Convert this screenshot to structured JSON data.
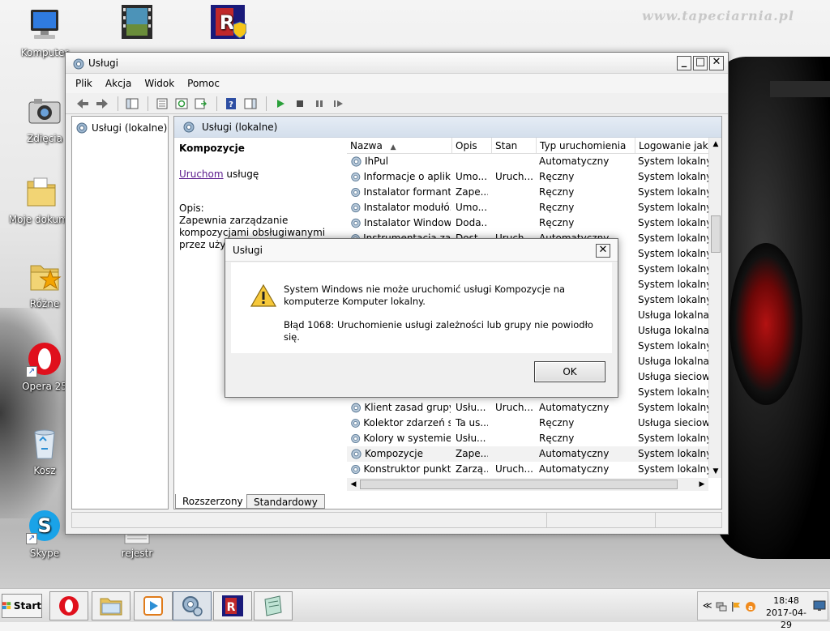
{
  "desktop": {
    "watermark": "www.tapeciarnia.pl",
    "icons": [
      {
        "label": "Komputer"
      },
      {
        "label": "Zdięcia"
      },
      {
        "label": "Moje dokume"
      },
      {
        "label": "Różne"
      },
      {
        "label": "Opera 25"
      },
      {
        "label": "Kosz"
      },
      {
        "label": "Skype"
      },
      {
        "label": "rejestr"
      }
    ]
  },
  "window": {
    "title": "Usługi",
    "menu": [
      "Plik",
      "Akcja",
      "Widok",
      "Pomoc"
    ],
    "tree_item": "Usługi (lokalne)",
    "pane_title": "Usługi (lokalne)",
    "selected_service": "Kompozycje",
    "start_link": "Uruchom",
    "start_suffix": " usługę",
    "desc_label": "Opis:",
    "desc_text": "Zapewnia zarządzanie kompozycjami obsługiwanymi przez użytkownika.",
    "columns": [
      "Nazwa",
      "Opis",
      "Stan",
      "Typ uruchomienia",
      "Logowanie jako"
    ],
    "rows": [
      {
        "name": "IhPul",
        "opis": "",
        "stan": "",
        "typ": "Automatyczny",
        "log": "System lokalny"
      },
      {
        "name": "Informacje o aplik...",
        "opis": "Umo...",
        "stan": "Uruch...",
        "typ": "Ręczny",
        "log": "System lokalny"
      },
      {
        "name": "Instalator formant...",
        "opis": "Zape...",
        "stan": "",
        "typ": "Ręczny",
        "log": "System lokalny"
      },
      {
        "name": "Instalator modułó...",
        "opis": "Umo...",
        "stan": "",
        "typ": "Ręczny",
        "log": "System lokalny"
      },
      {
        "name": "Instalator Windows",
        "opis": "Doda...",
        "stan": "",
        "typ": "Ręczny",
        "log": "System lokalny"
      },
      {
        "name": "Instrumentacja zar...",
        "opis": "Dost...",
        "stan": "Uruch...",
        "typ": "Automatyczny",
        "log": "System lokalny"
      },
      {
        "name": "",
        "opis": "",
        "stan": "",
        "typ": "",
        "log": "System lokalny"
      },
      {
        "name": "",
        "opis": "",
        "stan": "",
        "typ": "",
        "log": "System lokalny"
      },
      {
        "name": "",
        "opis": "",
        "stan": "",
        "typ": "",
        "log": "System lokalny"
      },
      {
        "name": "",
        "opis": "",
        "stan": "",
        "typ": "",
        "log": "System lokalny"
      },
      {
        "name": "",
        "opis": "",
        "stan": "",
        "typ": "",
        "log": "Usługa lokalna"
      },
      {
        "name": "",
        "opis": "",
        "stan": "",
        "typ": "",
        "log": "Usługa lokalna"
      },
      {
        "name": "",
        "opis": "",
        "stan": "",
        "typ": "",
        "log": "System lokalny"
      },
      {
        "name": "",
        "opis": "",
        "stan": "",
        "typ": "",
        "log": "Usługa lokalna"
      },
      {
        "name": "",
        "opis": "",
        "stan": "",
        "typ": "",
        "log": "Usługa sieciowa"
      },
      {
        "name": "",
        "opis": "",
        "stan": "",
        "typ": "",
        "log": "System lokalny"
      },
      {
        "name": "Klient zasad grupy",
        "opis": "Usłu...",
        "stan": "Uruch...",
        "typ": "Automatyczny",
        "log": "System lokalny"
      },
      {
        "name": "Kolektor zdarzeń s...",
        "opis": "Ta us...",
        "stan": "",
        "typ": "Ręczny",
        "log": "Usługa sieciowa"
      },
      {
        "name": "Kolory w systemie...",
        "opis": "Usłu...",
        "stan": "",
        "typ": "Ręczny",
        "log": "System lokalny"
      },
      {
        "name": "Kompozycje",
        "opis": "Zape...",
        "stan": "",
        "typ": "Automatyczny",
        "log": "System lokalny"
      },
      {
        "name": "Konstruktor punkt...",
        "opis": "Zarzą...",
        "stan": "Uruch...",
        "typ": "Automatyczny",
        "log": "System lokalny"
      }
    ],
    "tabs": [
      "Rozszerzony",
      "Standardowy"
    ]
  },
  "dialog": {
    "title": "Usługi",
    "line1": "System Windows nie może uruchomić usługi Kompozycje na komputerze Komputer lokalny.",
    "line2": "Błąd 1068: Uruchomienie usługi zależności lub grupy nie powiodło się.",
    "ok": "OK"
  },
  "taskbar": {
    "start": "Start",
    "time": "18:48",
    "date": "2017-04-29"
  }
}
